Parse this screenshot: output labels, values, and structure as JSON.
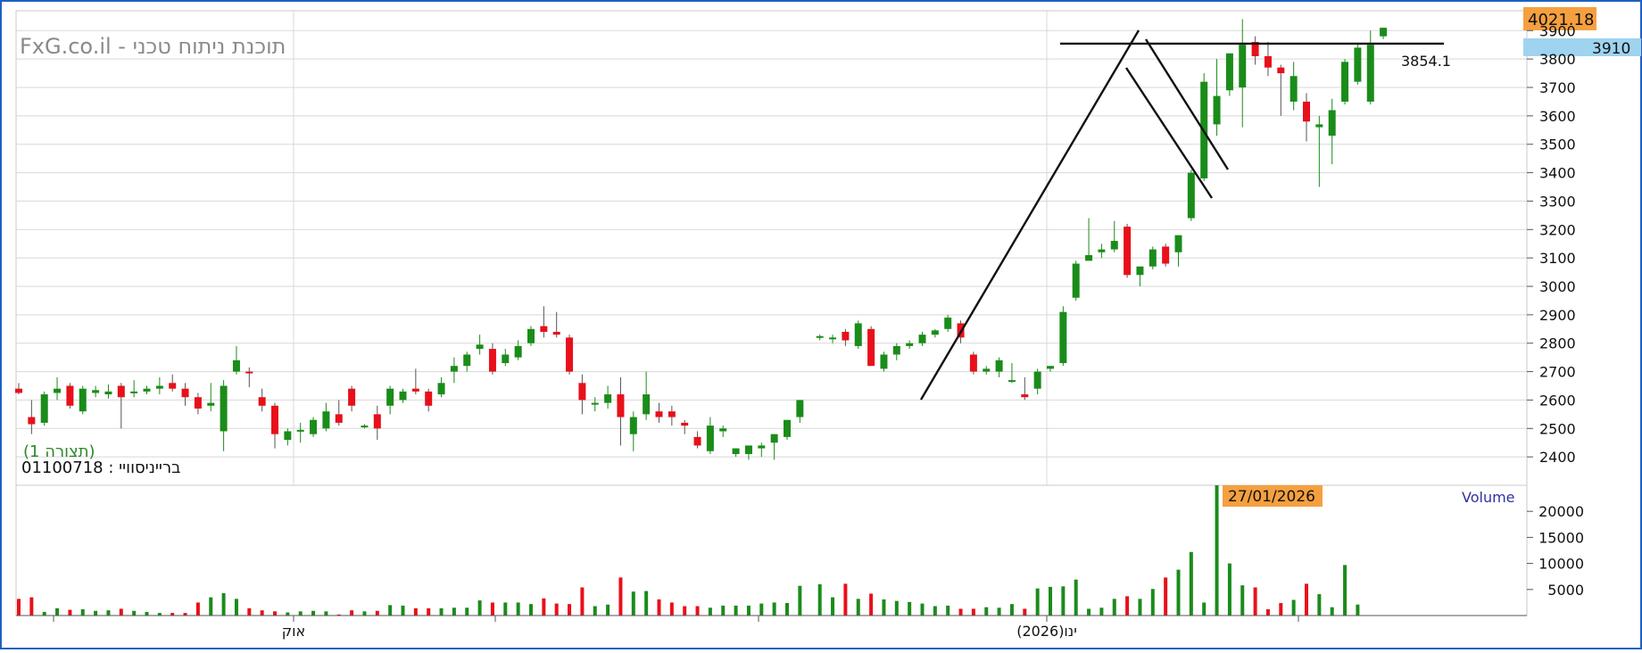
{
  "header": {
    "watermark": "FxG.co.il - תוכנת ניתוח טכני",
    "last_price_badge": "4021.18",
    "price_marker": "3910",
    "line_label": "3854.1",
    "pattern_label": "(תצורה 1)",
    "symbol_label": "ברייניסוויי : 01100718",
    "date_badge": "27/01/2026",
    "volume_label": "Volume"
  },
  "colors": {
    "up": "#1a8c1a",
    "down": "#e8101a",
    "badge_orange": "#f5a040",
    "marker_blue": "#9fd3f0",
    "grid": "#d8d8d8",
    "frame": "#2060c0",
    "volume_label": "#3030a0",
    "pattern_label": "#2a8a2a"
  },
  "chart_data": [
    {
      "type": "candlestick",
      "title": "",
      "x_ticks": [
        "אוק",
        "ינו(2026)"
      ],
      "y_ticks": [
        2400,
        2500,
        2600,
        2700,
        2800,
        2900,
        3000,
        3100,
        3200,
        3300,
        3400,
        3500,
        3600,
        3700,
        3800,
        3900
      ],
      "ylim": [
        2300,
        3970
      ],
      "grid": true,
      "horizontal_line": 3854.1,
      "series": [
        {
          "values": [
            [
              2640,
              2660,
              2620,
              2625
            ],
            [
              2540,
              2600,
              2480,
              2515
            ],
            [
              2520,
              2630,
              2510,
              2620
            ],
            [
              2625,
              2680,
              2600,
              2640
            ],
            [
              2650,
              2660,
              2570,
              2580
            ],
            [
              2560,
              2650,
              2550,
              2640
            ],
            [
              2625,
              2650,
              2610,
              2635
            ],
            [
              2620,
              2655,
              2605,
              2630
            ],
            [
              2650,
              2660,
              2500,
              2610
            ],
            [
              2625,
              2670,
              2610,
              2630
            ],
            [
              2630,
              2650,
              2620,
              2640
            ],
            [
              2640,
              2680,
              2620,
              2650
            ],
            [
              2660,
              2690,
              2630,
              2640
            ],
            [
              2640,
              2660,
              2580,
              2610
            ],
            [
              2610,
              2625,
              2550,
              2570
            ],
            [
              2580,
              2660,
              2560,
              2590
            ],
            [
              2490,
              2670,
              2420,
              2650
            ],
            [
              2700,
              2790,
              2690,
              2740
            ],
            [
              2700,
              2715,
              2645,
              2695
            ],
            [
              2610,
              2640,
              2560,
              2580
            ],
            [
              2580,
              2590,
              2430,
              2480
            ],
            [
              2460,
              2500,
              2440,
              2490
            ],
            [
              2490,
              2520,
              2450,
              2495
            ],
            [
              2480,
              2540,
              2470,
              2530
            ],
            [
              2500,
              2590,
              2490,
              2560
            ],
            [
              2550,
              2600,
              2510,
              2520
            ],
            [
              2640,
              2650,
              2560,
              2580
            ],
            [
              2510,
              2515,
              2500,
              2510
            ],
            [
              2550,
              2580,
              2460,
              2500
            ],
            [
              2580,
              2650,
              2550,
              2640
            ],
            [
              2600,
              2640,
              2590,
              2630
            ],
            [
              2640,
              2710,
              2620,
              2630
            ],
            [
              2630,
              2640,
              2560,
              2580
            ],
            [
              2620,
              2680,
              2610,
              2660
            ],
            [
              2700,
              2750,
              2660,
              2720
            ],
            [
              2720,
              2770,
              2700,
              2760
            ],
            [
              2780,
              2830,
              2760,
              2795
            ],
            [
              2780,
              2800,
              2690,
              2700
            ],
            [
              2730,
              2780,
              2720,
              2760
            ],
            [
              2750,
              2810,
              2740,
              2790
            ],
            [
              2800,
              2860,
              2790,
              2850
            ],
            [
              2860,
              2930,
              2820,
              2840
            ],
            [
              2840,
              2910,
              2820,
              2830
            ],
            [
              2820,
              2830,
              2690,
              2700
            ],
            [
              2660,
              2690,
              2550,
              2600
            ],
            [
              2590,
              2610,
              2560,
              2590
            ],
            [
              2590,
              2650,
              2570,
              2620
            ],
            [
              2620,
              2680,
              2440,
              2540
            ],
            [
              2480,
              2560,
              2420,
              2540
            ],
            [
              2550,
              2700,
              2530,
              2620
            ],
            [
              2560,
              2590,
              2520,
              2540
            ],
            [
              2560,
              2580,
              2510,
              2540
            ],
            [
              2520,
              2530,
              2480,
              2510
            ],
            [
              2470,
              2490,
              2430,
              2440
            ],
            [
              2420,
              2540,
              2410,
              2510
            ],
            [
              2490,
              2510,
              2470,
              2500
            ],
            [
              2410,
              2430,
              2400,
              2430
            ],
            [
              2410,
              2430,
              2390,
              2440
            ],
            [
              2430,
              2450,
              2400,
              2440
            ],
            [
              2450,
              2480,
              2390,
              2480
            ],
            [
              2470,
              2530,
              2460,
              2530
            ],
            [
              2540,
              2600,
              2520,
              2600
            ],
            [
              2820,
              2830,
              2810,
              2825
            ],
            [
              2815,
              2830,
              2800,
              2820
            ],
            [
              2840,
              2850,
              2790,
              2810
            ],
            [
              2790,
              2880,
              2780,
              2870
            ],
            [
              2850,
              2860,
              2720,
              2720
            ],
            [
              2710,
              2770,
              2700,
              2760
            ],
            [
              2760,
              2800,
              2740,
              2790
            ],
            [
              2790,
              2810,
              2780,
              2800
            ],
            [
              2800,
              2840,
              2790,
              2830
            ],
            [
              2830,
              2850,
              2820,
              2845
            ],
            [
              2850,
              2900,
              2840,
              2890
            ],
            [
              2870,
              2880,
              2800,
              2820
            ],
            [
              2760,
              2770,
              2690,
              2700
            ],
            [
              2700,
              2720,
              2690,
              2710
            ],
            [
              2700,
              2750,
              2680,
              2740
            ],
            [
              2670,
              2730,
              2660,
              2670
            ],
            [
              2620,
              2680,
              2600,
              2610
            ],
            [
              2640,
              2710,
              2620,
              2700
            ],
            [
              2710,
              2720,
              2700,
              2720
            ],
            [
              2730,
              2930,
              2720,
              2910
            ],
            [
              2960,
              3090,
              2950,
              3080
            ],
            [
              3090,
              3240,
              3090,
              3110
            ],
            [
              3120,
              3150,
              3100,
              3130
            ],
            [
              3130,
              3230,
              3120,
              3160
            ],
            [
              3210,
              3220,
              3030,
              3040
            ],
            [
              3040,
              3060,
              3000,
              3070
            ],
            [
              3070,
              3140,
              3060,
              3130
            ],
            [
              3140,
              3150,
              3070,
              3080
            ],
            [
              3120,
              3180,
              3070,
              3180
            ],
            [
              3240,
              3410,
              3230,
              3400
            ],
            [
              3380,
              3750,
              3370,
              3720
            ],
            [
              3570,
              3800,
              3530,
              3670
            ],
            [
              3690,
              3820,
              3670,
              3820
            ],
            [
              3700,
              3940,
              3560,
              3850
            ],
            [
              3860,
              3880,
              3780,
              3810
            ],
            [
              3810,
              3860,
              3740,
              3770
            ],
            [
              3770,
              3780,
              3600,
              3750
            ],
            [
              3650,
              3790,
              3620,
              3740
            ],
            [
              3650,
              3680,
              3510,
              3580
            ],
            [
              3560,
              3600,
              3350,
              3570
            ],
            [
              3530,
              3660,
              3430,
              3620
            ],
            [
              3650,
              3800,
              3640,
              3790
            ],
            [
              3720,
              3850,
              3710,
              3840
            ],
            [
              3650,
              3900,
              3640,
              3850
            ],
            [
              3880,
              3910,
              3870,
              3910
            ]
          ]
        }
      ]
    },
    {
      "type": "bar",
      "title": "Volume",
      "y_ticks": [
        5000,
        10000,
        15000,
        20000
      ],
      "ylim": [
        0,
        25000
      ],
      "series": [
        {
          "name": "Volume",
          "values": [
            3200,
            3500,
            700,
            1400,
            1100,
            1200,
            900,
            1000,
            1300,
            900,
            700,
            500,
            500,
            500,
            2500,
            3500,
            4300,
            3200,
            1400,
            1000,
            800,
            600,
            800,
            900,
            800,
            200,
            1000,
            800,
            900,
            2000,
            1900,
            1400,
            1400,
            1400,
            1500,
            1500,
            2900,
            2500,
            2500,
            2500,
            2200,
            3300,
            2300,
            2200,
            5400,
            1800,
            2100,
            7300,
            4600,
            4700,
            3100,
            2500,
            1800,
            1800,
            1500,
            1900,
            1900,
            1900,
            2300,
            2500,
            2400,
            5700,
            6000,
            3500,
            6100,
            3200,
            4200,
            3100,
            2800,
            2600,
            2300,
            1800,
            1900,
            1300,
            1300,
            1600,
            1500,
            2200,
            1300,
            5200,
            5500,
            5600,
            6900,
            1300,
            1500,
            3200,
            3700,
            3200,
            5100,
            7300,
            8800,
            12200,
            2500,
            25000,
            10000,
            5800,
            5400,
            1200,
            2400,
            3000,
            6100,
            4100,
            1600,
            9700,
            2100
          ]
        }
      ]
    }
  ]
}
